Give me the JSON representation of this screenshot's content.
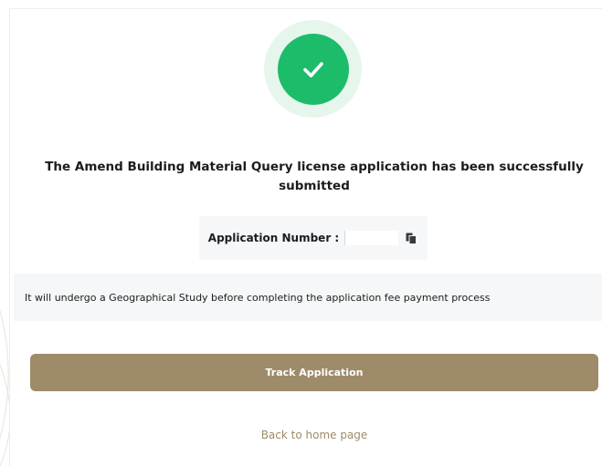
{
  "status": {
    "icon": "checkmark-icon",
    "color": "#1dbc6a",
    "halo_color": "#e6f6ec"
  },
  "message": {
    "title": "The Amend Building Material Query license application has been successfully submitted"
  },
  "application": {
    "number_label": "Application Number :",
    "number_value": "",
    "copy_icon": "copy-icon"
  },
  "notice": {
    "text": "It will undergo a Geographical Study before completing the application fee payment process"
  },
  "actions": {
    "track_label": "Track Application",
    "back_label": "Back to home page"
  },
  "colors": {
    "accent": "#9e8b69",
    "panel": "#f6f7f8"
  }
}
